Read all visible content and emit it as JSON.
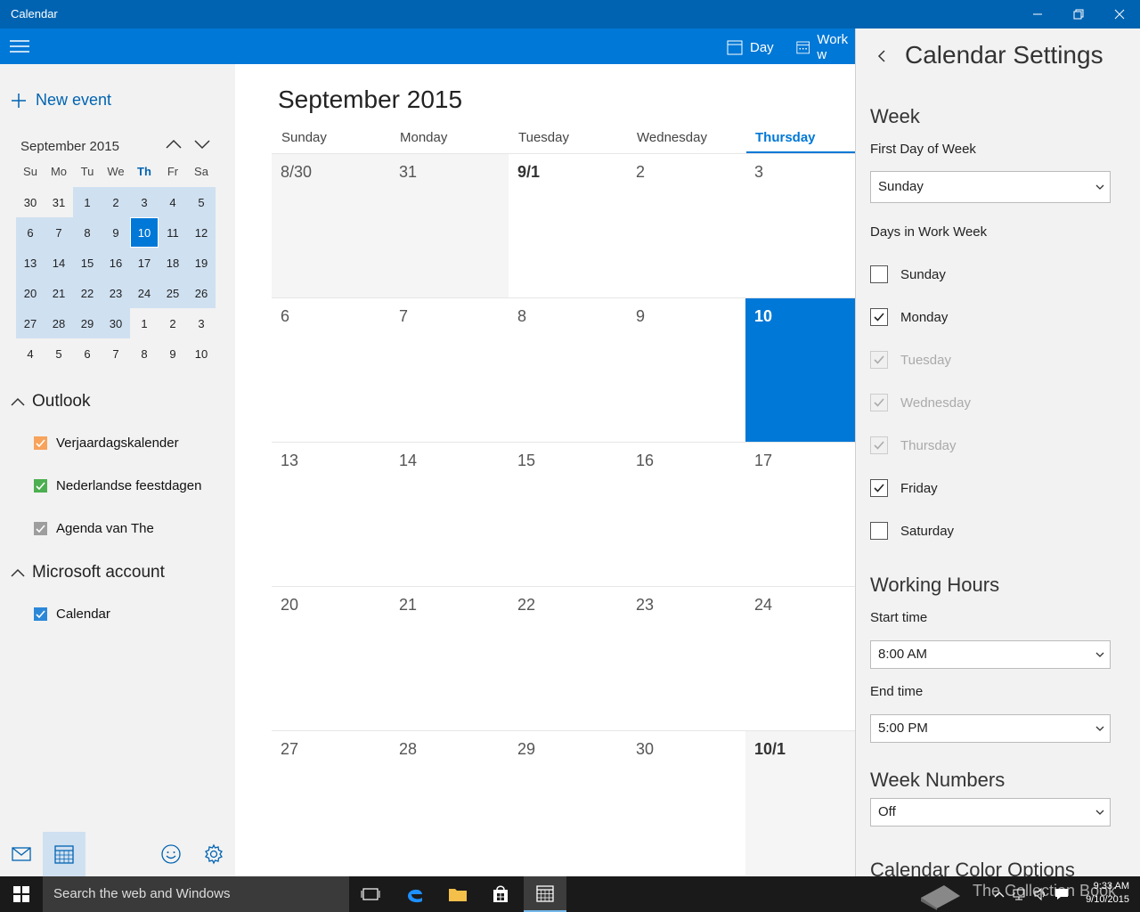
{
  "app": {
    "title": "Calendar"
  },
  "appbar": {
    "views": [
      {
        "label": "Day"
      },
      {
        "label": "Work w"
      }
    ]
  },
  "left": {
    "new_event": "New event",
    "mini_month": "September 2015",
    "weekday_headers": [
      "Su",
      "Mo",
      "Tu",
      "We",
      "Th",
      "Fr",
      "Sa"
    ],
    "weeks": [
      [
        "30",
        "31",
        "1",
        "2",
        "3",
        "4",
        "5"
      ],
      [
        "6",
        "7",
        "8",
        "9",
        "10",
        "11",
        "12"
      ],
      [
        "13",
        "14",
        "15",
        "16",
        "17",
        "18",
        "19"
      ],
      [
        "20",
        "21",
        "22",
        "23",
        "24",
        "25",
        "26"
      ],
      [
        "27",
        "28",
        "29",
        "30",
        "1",
        "2",
        "3"
      ],
      [
        "4",
        "5",
        "6",
        "7",
        "8",
        "9",
        "10"
      ]
    ],
    "groups": [
      {
        "name": "Outlook",
        "calendars": [
          {
            "name": "Verjaardagskalender",
            "color": "#f7a35c",
            "checked": true
          },
          {
            "name": "Nederlandse feestdagen",
            "color": "#4caf50",
            "checked": true
          },
          {
            "name": "Agenda van The",
            "color": "#9e9e9e",
            "checked": true
          }
        ]
      },
      {
        "name": "Microsoft account",
        "calendars": [
          {
            "name": "Calendar",
            "color": "#2b88d8",
            "checked": true
          }
        ]
      }
    ]
  },
  "main": {
    "month_title": "September 2015",
    "weekdays": [
      "Sunday",
      "Monday",
      "Tuesday",
      "Wednesday",
      "Thursday"
    ],
    "rows": [
      [
        "8/30",
        "31",
        "9/1",
        "2",
        "3"
      ],
      [
        "6",
        "7",
        "8",
        "9",
        "10"
      ],
      [
        "13",
        "14",
        "15",
        "16",
        "17"
      ],
      [
        "20",
        "21",
        "22",
        "23",
        "24"
      ],
      [
        "27",
        "28",
        "29",
        "30",
        "10/1"
      ]
    ]
  },
  "settings": {
    "title": "Calendar Settings",
    "week_section": "Week",
    "first_day_label": "First Day of Week",
    "first_day_value": "Sunday",
    "work_week_label": "Days in Work Week",
    "days": [
      {
        "name": "Sunday",
        "checked": false,
        "disabled": false
      },
      {
        "name": "Monday",
        "checked": true,
        "disabled": false
      },
      {
        "name": "Tuesday",
        "checked": true,
        "disabled": true
      },
      {
        "name": "Wednesday",
        "checked": true,
        "disabled": true
      },
      {
        "name": "Thursday",
        "checked": true,
        "disabled": true
      },
      {
        "name": "Friday",
        "checked": true,
        "disabled": false
      },
      {
        "name": "Saturday",
        "checked": false,
        "disabled": false
      }
    ],
    "working_hours_section": "Working Hours",
    "start_label": "Start time",
    "start_value": "8:00 AM",
    "end_label": "End time",
    "end_value": "5:00 PM",
    "week_numbers_section": "Week Numbers",
    "week_numbers_value": "Off",
    "color_options_section": "Calendar Color Options"
  },
  "taskbar": {
    "search_placeholder": "Search the web and Windows",
    "watermark": "The Collection Book",
    "time": "9:33 AM",
    "date": "9/10/2015"
  },
  "colors": {
    "accent": "#0078d7",
    "titlebar": "#0063b1",
    "today": "#0078d7"
  }
}
